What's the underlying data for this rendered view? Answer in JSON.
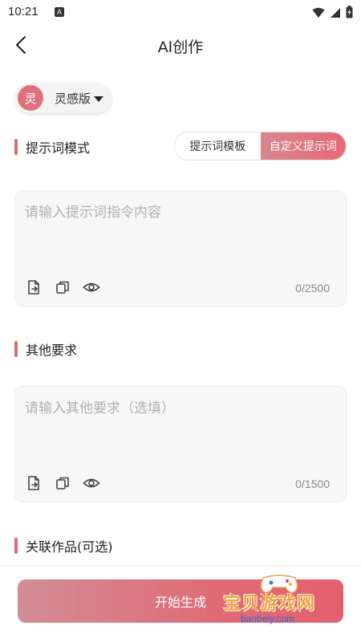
{
  "status_bar": {
    "time": "10:21",
    "notification_letter": "A"
  },
  "header": {
    "title": "AI创作"
  },
  "version": {
    "avatar_text": "灵",
    "label": "灵感版"
  },
  "prompt_section": {
    "title": "提示词模式",
    "modes": [
      {
        "label": "提示词模板",
        "active": false
      },
      {
        "label": "自定义提示词",
        "active": true
      }
    ],
    "input": {
      "placeholder": "请输入提示词指令内容",
      "value": "",
      "counter": "0/2500"
    }
  },
  "other_section": {
    "title": "其他要求",
    "input": {
      "placeholder": "请输入其他要求（选填）",
      "value": "",
      "counter": "0/1500"
    }
  },
  "related_section": {
    "title": "关联作品(可选)"
  },
  "footer": {
    "generate_label": "开始生成"
  },
  "watermark": {
    "text": "宝贝游戏网",
    "url": "baobeiy.com"
  },
  "colors": {
    "accent": "#e06a74",
    "accent_light": "#d9858e"
  }
}
